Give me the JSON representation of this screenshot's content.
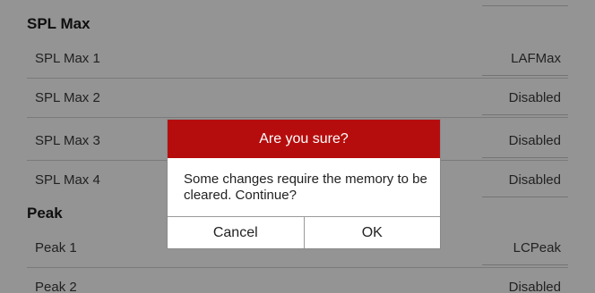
{
  "sections": {
    "spl_max": {
      "title": "SPL Max",
      "rows": [
        {
          "label": "SPL Max 1",
          "value": "LAFMax"
        },
        {
          "label": "SPL Max 2",
          "value": "Disabled"
        },
        {
          "label": "SPL Max 3",
          "value": "Disabled"
        },
        {
          "label": "SPL Max 4",
          "value": "Disabled"
        }
      ]
    },
    "peak": {
      "title": "Peak",
      "rows": [
        {
          "label": "Peak 1",
          "value": "LCPeak"
        },
        {
          "label": "Peak 2",
          "value": "Disabled"
        }
      ]
    }
  },
  "dialog": {
    "title": "Are you sure?",
    "message": "Some changes require the memory to be cleared. Continue?",
    "cancel_label": "Cancel",
    "ok_label": "OK"
  },
  "colors": {
    "dialog_title_bg": "#b50d0d",
    "scrim": "rgba(0,0,0,0.42)"
  }
}
